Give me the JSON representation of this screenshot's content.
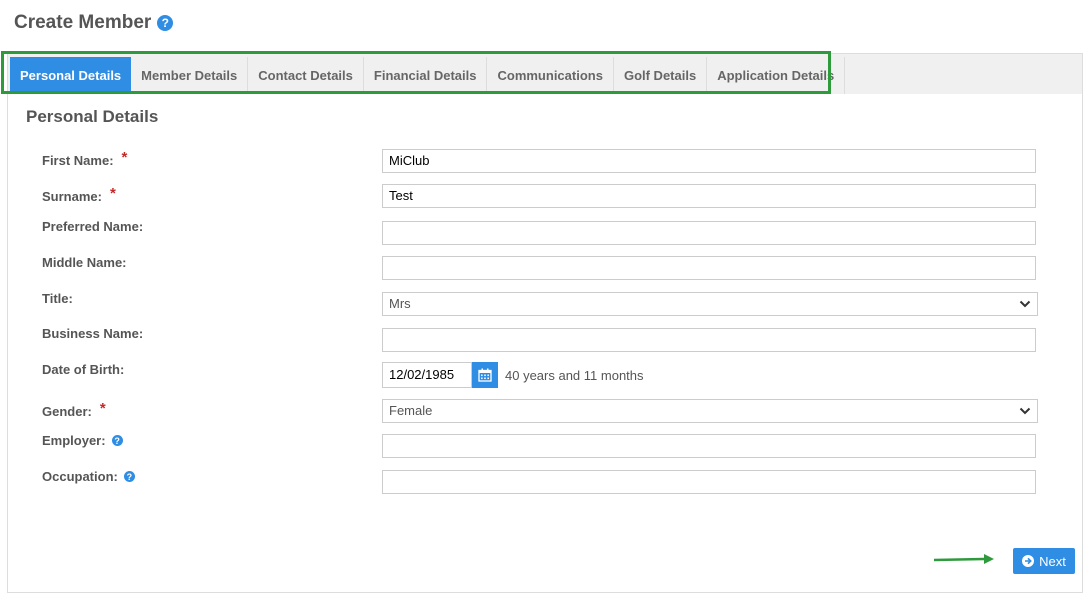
{
  "page": {
    "title": "Create Member"
  },
  "tabs": [
    {
      "label": "Personal Details",
      "active": true
    },
    {
      "label": "Member Details"
    },
    {
      "label": "Contact Details"
    },
    {
      "label": "Financial Details"
    },
    {
      "label": "Communications"
    },
    {
      "label": "Golf Details"
    },
    {
      "label": "Application Details"
    }
  ],
  "section": {
    "title": "Personal Details"
  },
  "form": {
    "first_name": {
      "label": "First Name:",
      "value": "MiClub",
      "required": true
    },
    "surname": {
      "label": "Surname:",
      "value": "Test",
      "required": true
    },
    "preferred_name": {
      "label": "Preferred Name:",
      "value": ""
    },
    "middle_name": {
      "label": "Middle Name:",
      "value": ""
    },
    "title": {
      "label": "Title:",
      "value": "Mrs"
    },
    "business_name": {
      "label": "Business Name:",
      "value": ""
    },
    "dob": {
      "label": "Date of Birth:",
      "value": "12/02/1985",
      "age_text": "40 years and 11 months"
    },
    "gender": {
      "label": "Gender:",
      "value": "Female",
      "required": true
    },
    "employer": {
      "label": "Employer:",
      "value": ""
    },
    "occupation": {
      "label": "Occupation:",
      "value": ""
    },
    "required_mark": "*",
    "help_glyph": "?"
  },
  "actions": {
    "next_label": "Next"
  },
  "colors": {
    "accent": "#2f8de4",
    "highlight": "#2e9a3c",
    "required": "#c62828"
  }
}
